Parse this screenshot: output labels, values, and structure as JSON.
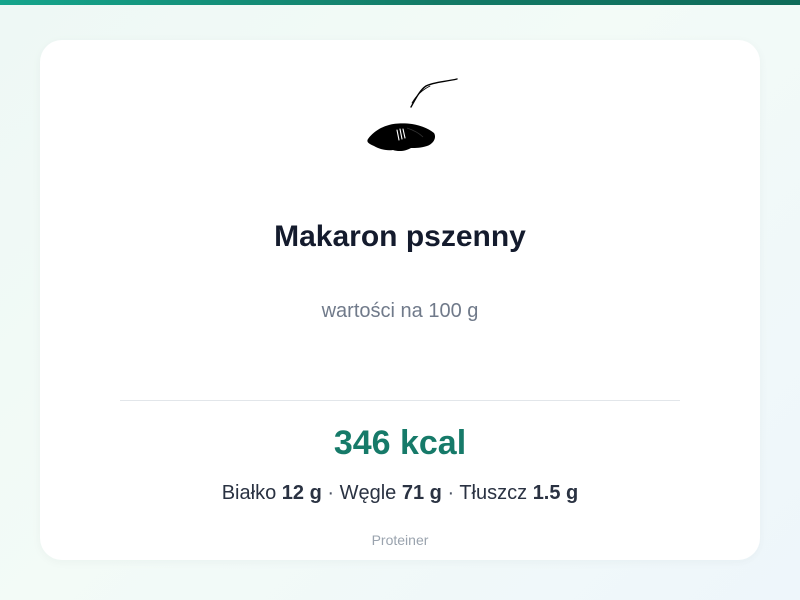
{
  "product": {
    "title": "Makaron pszenny",
    "serving_note": "wartości na 100 g"
  },
  "nutrition": {
    "calories": "346 kcal",
    "protein_label": "Białko",
    "protein_value": "12 g",
    "carbs_label": "Węgle",
    "carbs_value": "71 g",
    "fat_label": "Tłuszcz",
    "fat_value": "1.5 g",
    "separator": "·"
  },
  "footer": {
    "brand": "Proteiner"
  },
  "icons": {
    "food": "pasta-illustration-icon"
  },
  "colors": {
    "accent": "#167a69",
    "top_bar": "#15a58c",
    "title": "#141b2d",
    "muted": "#707a8a"
  }
}
